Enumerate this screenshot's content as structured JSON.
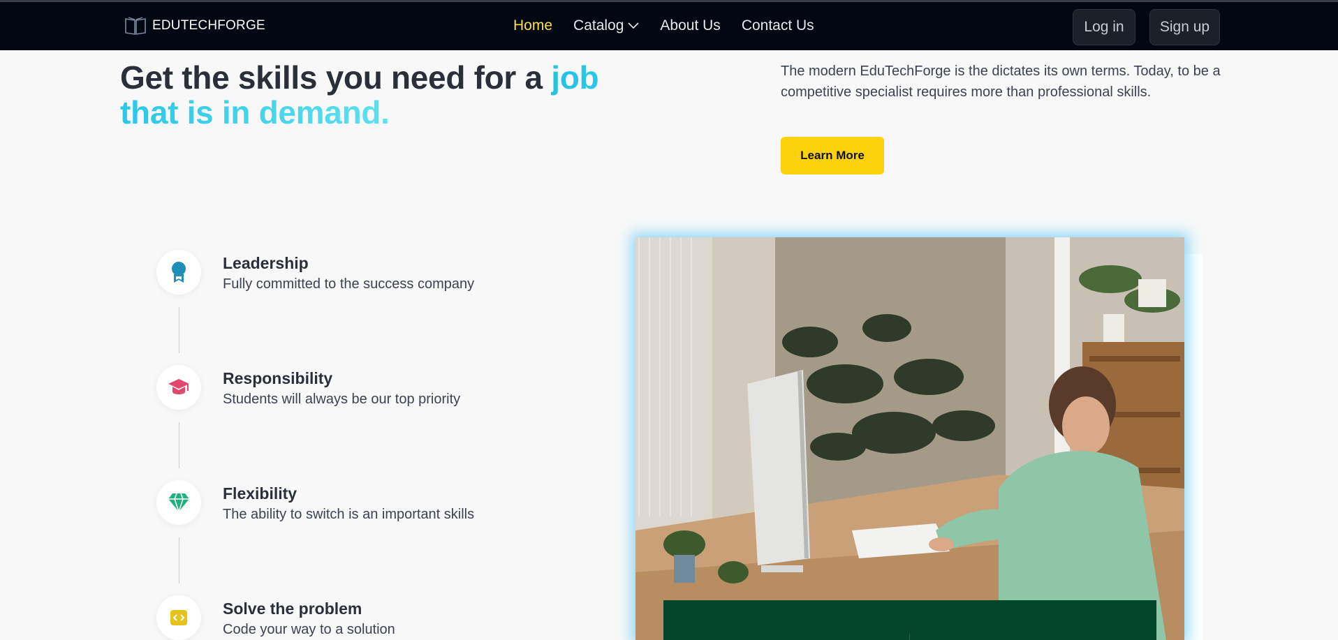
{
  "nav": {
    "logo_text": "EDUTECHFORGE",
    "items": [
      {
        "label": "Home",
        "active": true
      },
      {
        "label": "Catalog",
        "has_dropdown": true
      },
      {
        "label": "About Us"
      },
      {
        "label": "Contact Us"
      }
    ],
    "login_label": "Log in",
    "signup_label": "Sign up",
    "active_color": "#fde047",
    "background": "#020812"
  },
  "hero": {
    "title_main": "Get the skills you need for a ",
    "title_accent": "job that is in demand.",
    "accent_color": "#22c3e6",
    "description": "The modern EduTechForge is the dictates its own terms. Today, to be a competitive specialist requires more than professional skills.",
    "cta_label": "Learn More",
    "cta_color": "#fcd20e"
  },
  "features": [
    {
      "icon": "ribbon-award-icon",
      "title": "Leadership",
      "description": "Fully committed to the success company",
      "icon_color": "#1f8fb8"
    },
    {
      "icon": "graduation-cap-icon",
      "title": "Responsibility",
      "description": "Students will always be our top priority",
      "icon_color": "#e0476b"
    },
    {
      "icon": "diamond-icon",
      "title": "Flexibility",
      "description": "The ability to switch is an important skills",
      "icon_color": "#22b07d"
    },
    {
      "icon": "code-brackets-icon",
      "title": "Solve the problem",
      "description": "Code your way to a solution",
      "icon_color": "#e5c21c"
    }
  ],
  "image": {
    "subject": "woman-at-computer-photo",
    "card_color": "#03462c"
  }
}
